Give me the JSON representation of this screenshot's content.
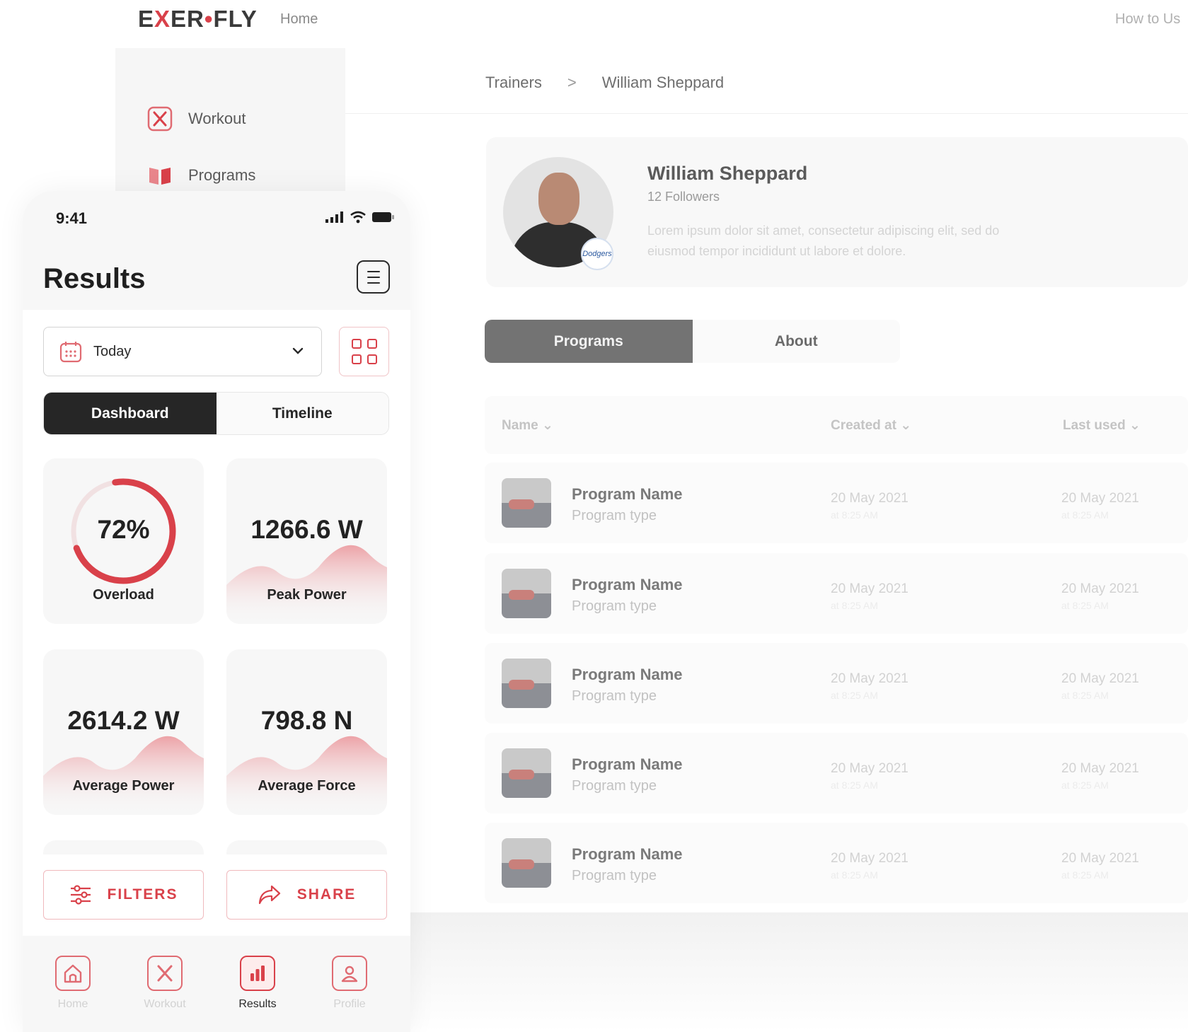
{
  "brand": {
    "logo_prefix": "E",
    "logo_x": "X",
    "logo_mid": "ER",
    "logo_dot": "•",
    "logo_suffix": "FLY",
    "accent": "#d9414a"
  },
  "topnav": {
    "home": "Home",
    "how_to": "How to Us"
  },
  "sidebar": {
    "items": [
      {
        "label": "Workout",
        "icon": "x-logo-icon"
      },
      {
        "label": "Programs",
        "icon": "book-icon"
      }
    ]
  },
  "breadcrumb": {
    "parent": "Trainers",
    "separator": ">",
    "current": "William Sheppard"
  },
  "profile": {
    "name": "William Sheppard",
    "followers": "12 Followers",
    "badge": "Dodgers",
    "description": "Lorem ipsum dolor sit amet, consectetur adipiscing elit, sed do eiusmod tempor incididunt ut labore et dolore."
  },
  "profile_tabs": {
    "programs": "Programs",
    "about": "About",
    "active": "Programs"
  },
  "table": {
    "headers": {
      "name": "Name",
      "created": "Created at",
      "last_used": "Last used"
    },
    "rows": [
      {
        "name": "Program Name",
        "type": "Program type",
        "created": "20 May 2021",
        "created_time": "at 8:25 AM",
        "last_used": "20 May 2021",
        "last_time": "at 8:25 AM"
      },
      {
        "name": "Program Name",
        "type": "Program type",
        "created": "20 May 2021",
        "created_time": "at 8:25 AM",
        "last_used": "20 May 2021",
        "last_time": "at 8:25 AM"
      },
      {
        "name": "Program Name",
        "type": "Program type",
        "created": "20 May 2021",
        "created_time": "at 8:25 AM",
        "last_used": "20 May 2021",
        "last_time": "at 8:25 AM"
      },
      {
        "name": "Program Name",
        "type": "Program type",
        "created": "20 May 2021",
        "created_time": "at 8:25 AM",
        "last_used": "20 May 2021",
        "last_time": "at 8:25 AM"
      },
      {
        "name": "Program Name",
        "type": "Program type",
        "created": "20 May 2021",
        "created_time": "at 8:25 AM",
        "last_used": "20 May 2021",
        "last_time": "at 8:25 AM"
      }
    ]
  },
  "phone": {
    "status_time": "9:41",
    "title": "Results",
    "date_select": {
      "value": "Today"
    },
    "segments": {
      "dashboard": "Dashboard",
      "timeline": "Timeline",
      "active": "Dashboard"
    },
    "tiles": {
      "overload": {
        "value": "72%",
        "caption": "Overload",
        "progress": 0.72
      },
      "peak_power": {
        "value": "1266.6 W",
        "caption": "Peak Power"
      },
      "average_power": {
        "value": "2614.2 W",
        "caption": "Average Power"
      },
      "average_force": {
        "value": "798.8 N",
        "caption": "Average Force"
      }
    },
    "actions": {
      "filters": "FILTERS",
      "share": "SHARE"
    },
    "tabbar": [
      {
        "label": "Home",
        "icon": "home-icon"
      },
      {
        "label": "Workout",
        "icon": "workout-icon"
      },
      {
        "label": "Results",
        "icon": "bar-chart-icon",
        "active": true
      },
      {
        "label": "Profile",
        "icon": "profile-icon"
      }
    ]
  }
}
